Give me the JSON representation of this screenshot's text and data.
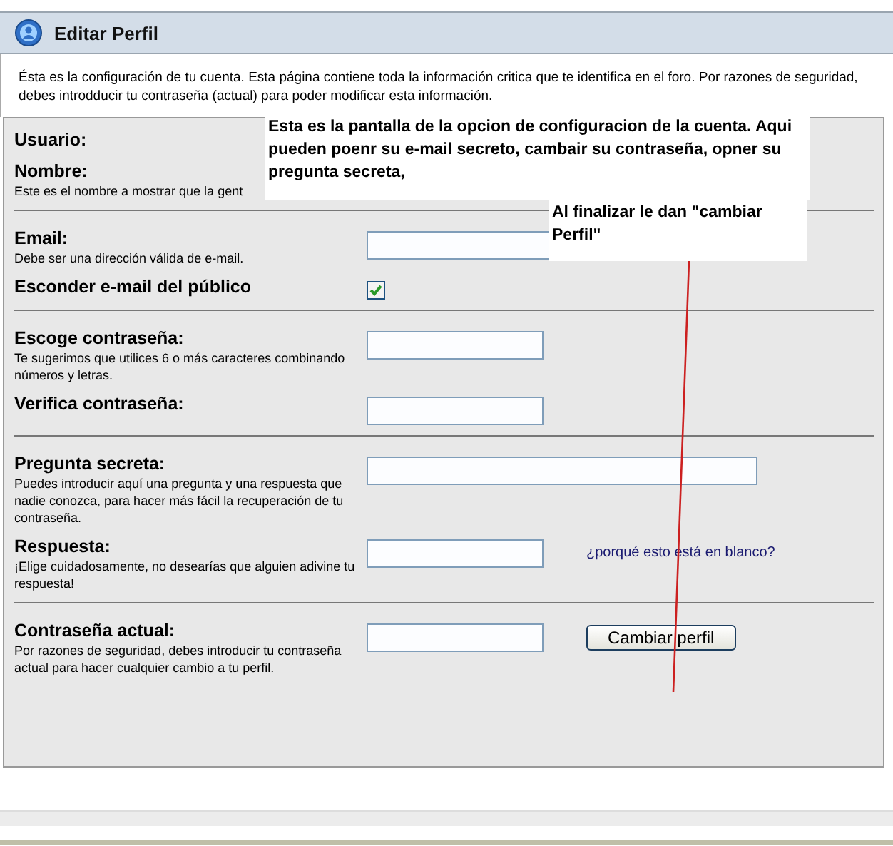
{
  "window": {
    "title": "Editar Perfil"
  },
  "intro": "Ésta es la configuración de tu cuenta. Esta página contiene toda la información critica que te identifica en el foro. Por razones de seguridad, debes introdducir tu contraseña (actual) para poder modificar esta información.",
  "sections": [
    {
      "rows": [
        {
          "label": "Usuario:",
          "kind": "none"
        },
        {
          "label": "Nombre:",
          "help": "Este es el nombre a mostrar que la gent",
          "kind": "none"
        }
      ]
    },
    {
      "rows": [
        {
          "label": "Email:",
          "help": "Debe ser una dirección válida de e-mail.",
          "kind": "medium-field"
        },
        {
          "label": "Esconder e-mail del público",
          "kind": "checkbox",
          "checked": true
        }
      ]
    },
    {
      "rows": [
        {
          "label": "Escoge contraseña:",
          "help": "Te sugerimos que utilices 6 o más caracteres combinando números y letras.",
          "kind": "short-field"
        },
        {
          "label": "Verifica contraseña:",
          "kind": "short-field"
        }
      ]
    },
    {
      "rows": [
        {
          "label": "Pregunta secreta:",
          "help": "Puedes introducir aquí una pregunta y una respuesta que nadie conozca, para hacer más fácil la recuperación de tu contraseña.",
          "kind": "long-field"
        },
        {
          "label": "Respuesta:",
          "help": "¡Elige cuidadosamente, no desearías que alguien adivine tu respuesta!",
          "kind": "short-field",
          "link": "¿porqué esto está en blanco?"
        }
      ]
    },
    {
      "rows": [
        {
          "label": "Contraseña actual:",
          "help": "Por razones de seguridad, debes introducir tu contraseña actual para hacer cualquier cambio a tu perfil.",
          "kind": "short-field",
          "button": "Cambiar perfil"
        }
      ]
    }
  ],
  "annotations": [
    {
      "text": "Esta es la pantalla de la opcion de configuracion de la cuenta. Aqui pueden poenr su e-mail secreto, cambair su contraseña, opner su pregunta secreta,"
    },
    {
      "text": "Al finalizar le dan \"cambiar Perfil\""
    }
  ]
}
